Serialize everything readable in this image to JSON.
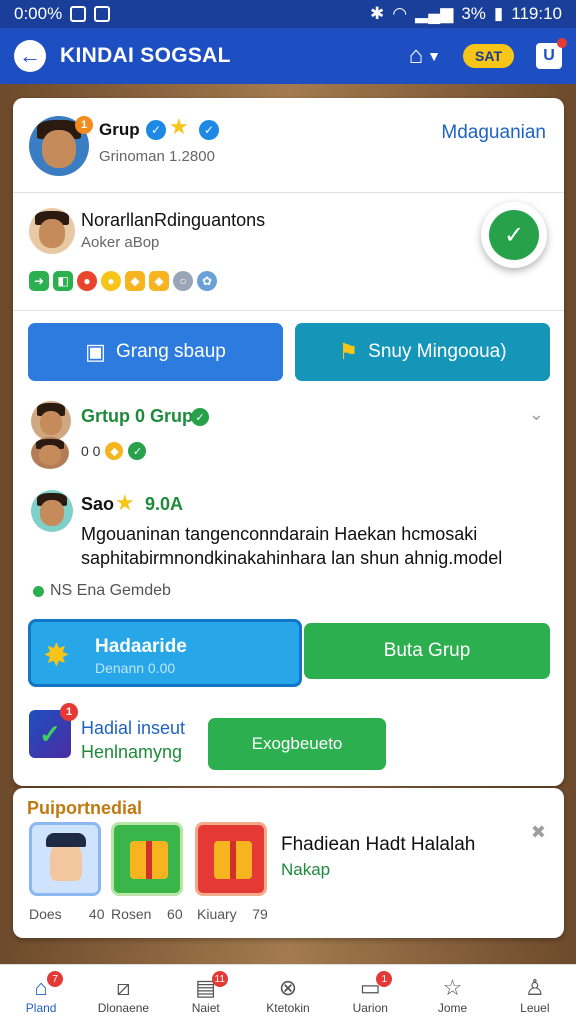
{
  "status_bar": {
    "left_text": "0:00%",
    "right_battery": "3%",
    "time": "119:10"
  },
  "app_bar": {
    "title": "KINDAI SOGSAL",
    "pill_label": "SAT",
    "bag_label": "U"
  },
  "owner": {
    "name": "Grup",
    "subtitle": "Grinoman 1.2800",
    "manage_label": "Mdaguanian",
    "badge": "1"
  },
  "member": {
    "name": "NorarllanRdinguantons",
    "subtitle": "Aoker aBop"
  },
  "action_buttons": {
    "left_label": "Grang sbaup",
    "right_label": "Snuy Mingooua)"
  },
  "group": {
    "name": "Grtup 0 Grup",
    "icons_text": "0 0"
  },
  "post": {
    "author": "Sao",
    "score": "9.0A",
    "text": "Mgouaninan tangenconndarain Haekan hcmosaki saphitabirmnondkinakahinhara lan shun ahnig.model"
  },
  "online_status": "NS Ena Gemdeb",
  "promo": {
    "title": "Hadaaride",
    "subtitle": "Denann 0.00"
  },
  "buta_grup_label": "Buta Grup",
  "mini": {
    "title": "Hadial inseut",
    "subtitle": "Henlnamyng",
    "button_label": "Exogbeueto",
    "badge": "1"
  },
  "rewards": {
    "title": "Puiportnedial",
    "tiles": [
      {
        "label": "Does",
        "value": "40"
      },
      {
        "label": "Rosen",
        "value": "60"
      },
      {
        "label": "Kiuary",
        "value": "79"
      }
    ],
    "message_title": "Fhadiean Hadt Halalah",
    "message_sub": "Nakap"
  },
  "bottom_nav": [
    {
      "label": "Pland",
      "icon": "home-icon",
      "badge": "7"
    },
    {
      "label": "Dlonaene",
      "icon": "n-icon",
      "badge": ""
    },
    {
      "label": "Naiet",
      "icon": "chart-icon",
      "badge": "11"
    },
    {
      "label": "Ktetokin",
      "icon": "close-circle-icon",
      "badge": ""
    },
    {
      "label": "Uarion",
      "icon": "chat-icon",
      "badge": "1"
    },
    {
      "label": "Jome",
      "icon": "star-icon",
      "badge": ""
    },
    {
      "label": "Leuel",
      "icon": "user-icon",
      "badge": ""
    }
  ]
}
